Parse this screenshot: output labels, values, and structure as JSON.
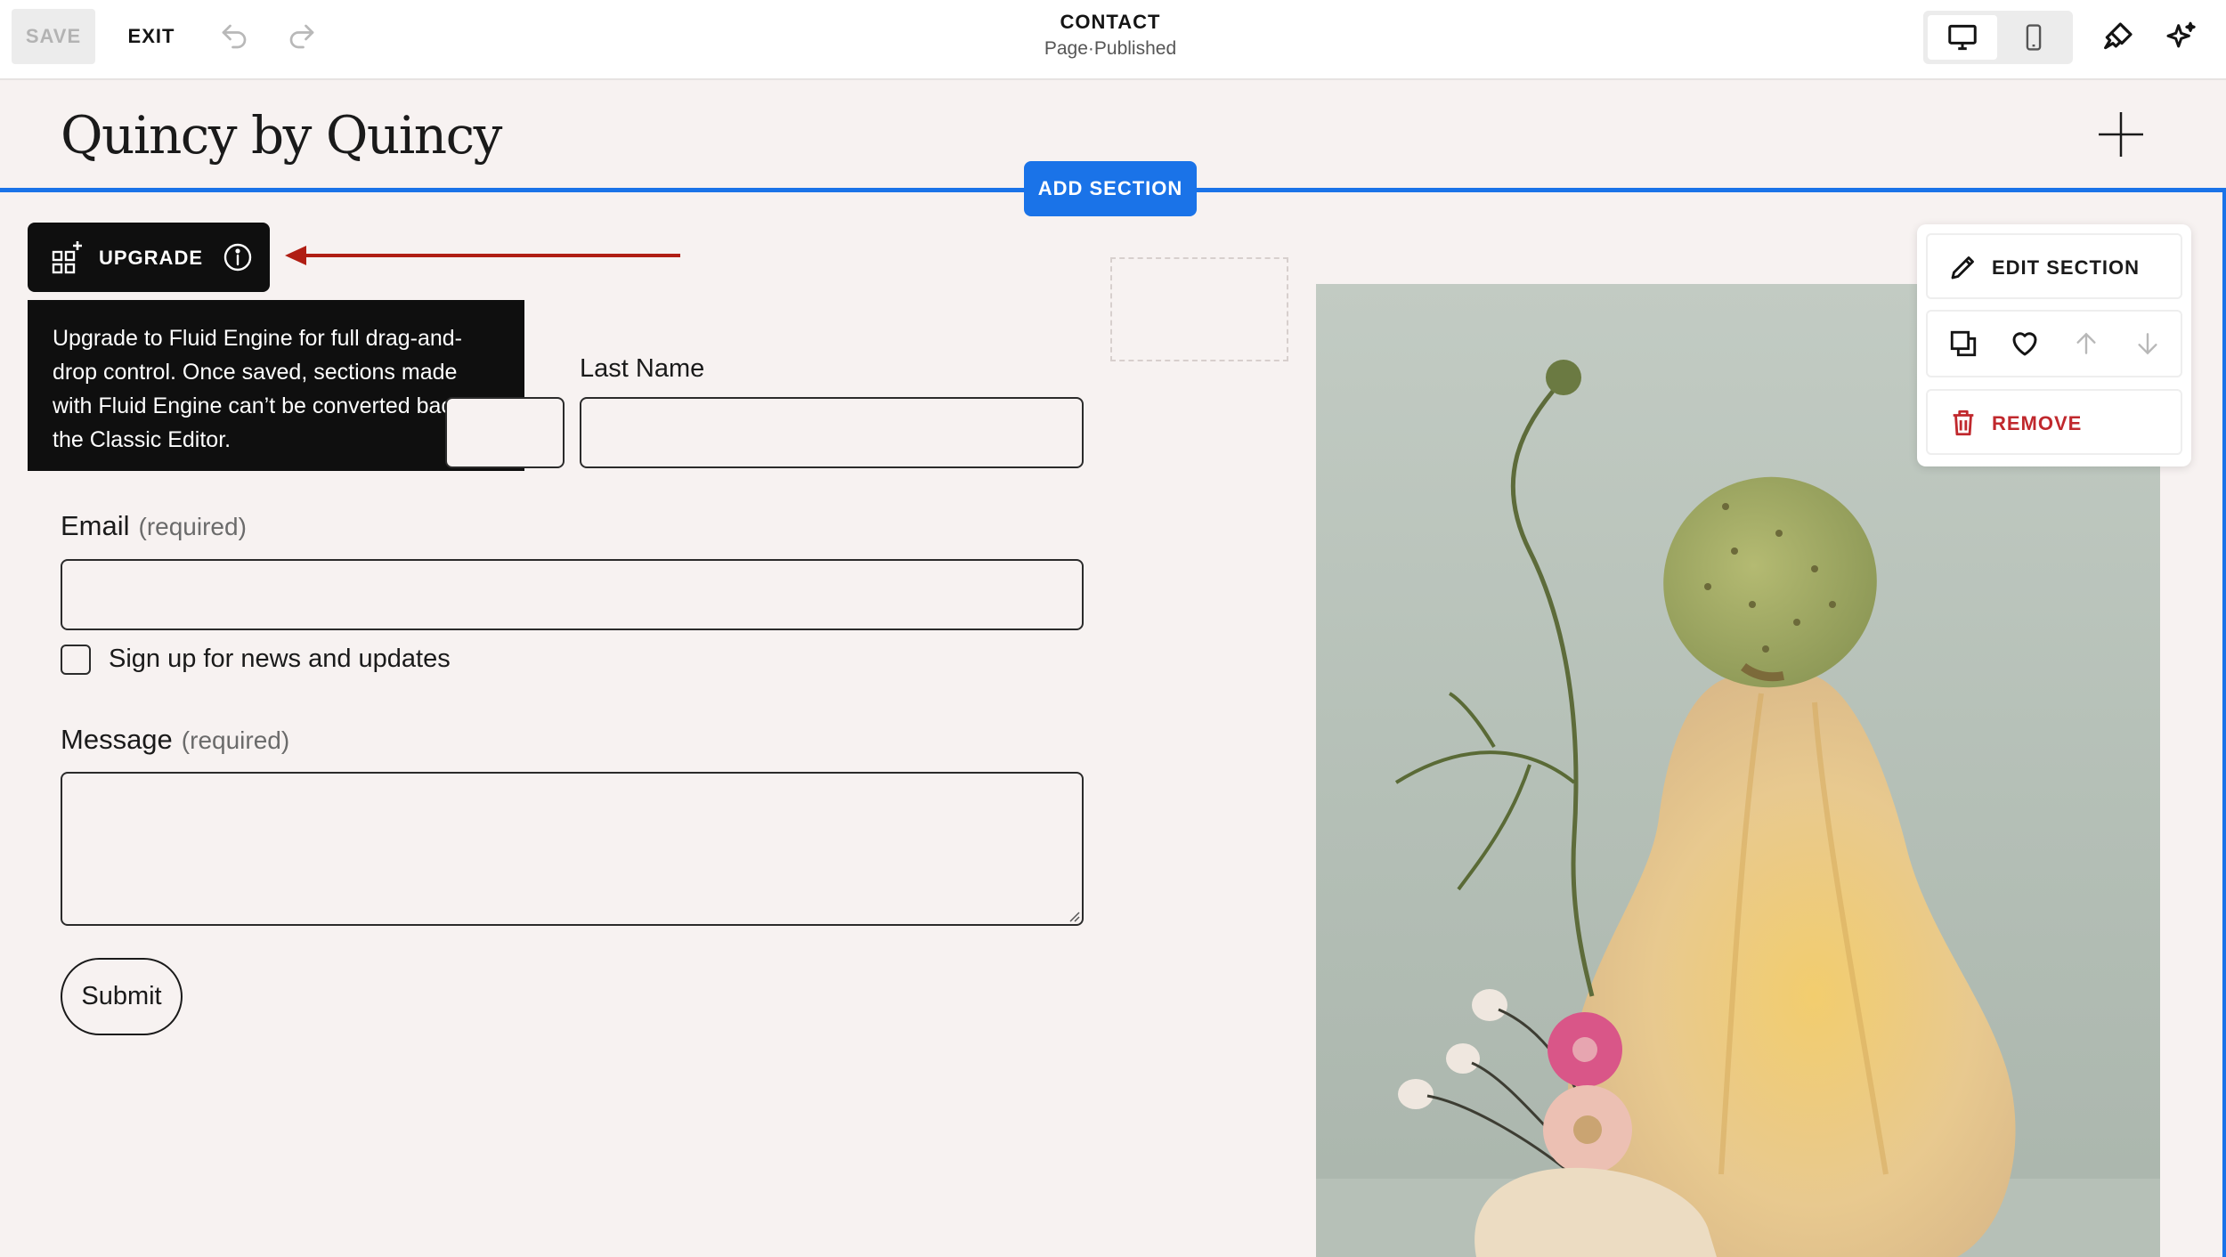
{
  "toolbar": {
    "save_label": "SAVE",
    "exit_label": "EXIT",
    "page_title": "CONTACT",
    "page_type": "Page",
    "status_separator": " · ",
    "page_status": "Published",
    "icons": [
      "undo-icon",
      "redo-icon",
      "desktop-icon",
      "mobile-icon",
      "design-brush-icon",
      "sparkle-icon"
    ]
  },
  "site": {
    "logo_text": "Quincy by Quincy"
  },
  "section": {
    "add_section_label": "ADD SECTION",
    "upgrade_label": "UPGRADE",
    "upgrade_tooltip": "Upgrade to Fluid Engine for full drag-and-drop control. Once saved, sections made with Fluid Engine can’t be converted back to the Classic Editor."
  },
  "form": {
    "last_name_label": "Last Name",
    "email_label": "Email",
    "email_required": "(required)",
    "newsletter_label": "Sign up for news and updates",
    "message_label": "Message",
    "message_required": "(required)",
    "submit_label": "Submit"
  },
  "section_menu": {
    "edit_label": "EDIT SECTION",
    "remove_label": "REMOVE",
    "action_icons": [
      "duplicate-icon",
      "heart-icon",
      "arrow-up-icon",
      "arrow-down-icon"
    ]
  },
  "colors": {
    "accent": "#1a73e8",
    "page_background": "#f7f2f1",
    "danger": "#c0282d",
    "annotation_arrow": "#b01e14"
  }
}
